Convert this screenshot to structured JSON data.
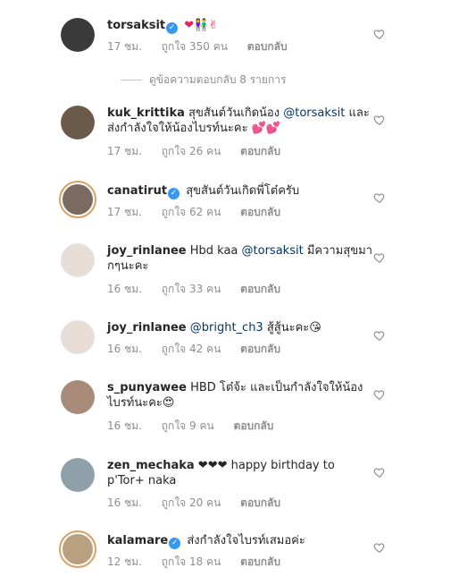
{
  "comments": [
    {
      "username": "torsaksit",
      "verified": true,
      "text": "❤👫✌",
      "time": "17 ชม.",
      "likes": "ถูกใจ 350 คน",
      "reply": "ตอบกลับ"
    },
    {
      "username": "kuk_krittika",
      "verified": false,
      "text_before": "สุขสันต์วันเกิดน้อง ",
      "mention": "@torsaksit",
      "text_after": " และส่งกำลังใจให้น้องไบรท์นะคะ 💕💕",
      "time": "17 ชม.",
      "likes": "ถูกใจ 26 คน",
      "reply": "ตอบกลับ"
    },
    {
      "username": "canatirut",
      "verified": true,
      "text": "สุขสันต์วันเกิดพี่โต๋ครับ",
      "time": "17 ชม.",
      "likes": "ถูกใจ 62 คน",
      "reply": "ตอบกลับ"
    },
    {
      "username": "joy_rinlanee",
      "verified": false,
      "text_before": "Hbd kaa ",
      "mention": "@torsaksit",
      "text_after": " มีความสุขมากๆนะคะ",
      "time": "16 ชม.",
      "likes": "ถูกใจ 33 คน",
      "reply": "ตอบกลับ"
    },
    {
      "username": "joy_rinlanee",
      "verified": false,
      "text_before": "",
      "mention": "@bright_ch3",
      "text_after": " สู้สู้นะคะ😘",
      "time": "16 ชม.",
      "likes": "ถูกใจ 42 คน",
      "reply": "ตอบกลับ"
    },
    {
      "username": "s_punyawee",
      "verified": false,
      "text": "HBD โต๋จ้ะ และเป็นกำลังใจให้น้องไบรท์นะคะ😍",
      "time": "16 ชม.",
      "likes": "ถูกใจ 9 คน",
      "reply": "ตอบกลับ"
    },
    {
      "username": "zen_mechaka",
      "verified": false,
      "text": "❤❤❤ happy birthday to p'Tor+ naka",
      "time": "16 ชม.",
      "likes": "ถูกใจ 20 คน",
      "reply": "ตอบกลับ"
    },
    {
      "username": "kalamare",
      "verified": true,
      "text": "ส่งกำลังใจไบรท์เสมอค่ะ",
      "time": "12 ชม.",
      "likes": "ถูกใจ 18 คน",
      "reply": "ตอบกลับ"
    }
  ],
  "thread_toggle": "ดูข้อความตอบกลับ 8 รายการ",
  "colors": {
    "link": "#00376b",
    "meta": "#8e8e8e",
    "verified": "#3897f0",
    "story_ring": "#d9a066"
  }
}
